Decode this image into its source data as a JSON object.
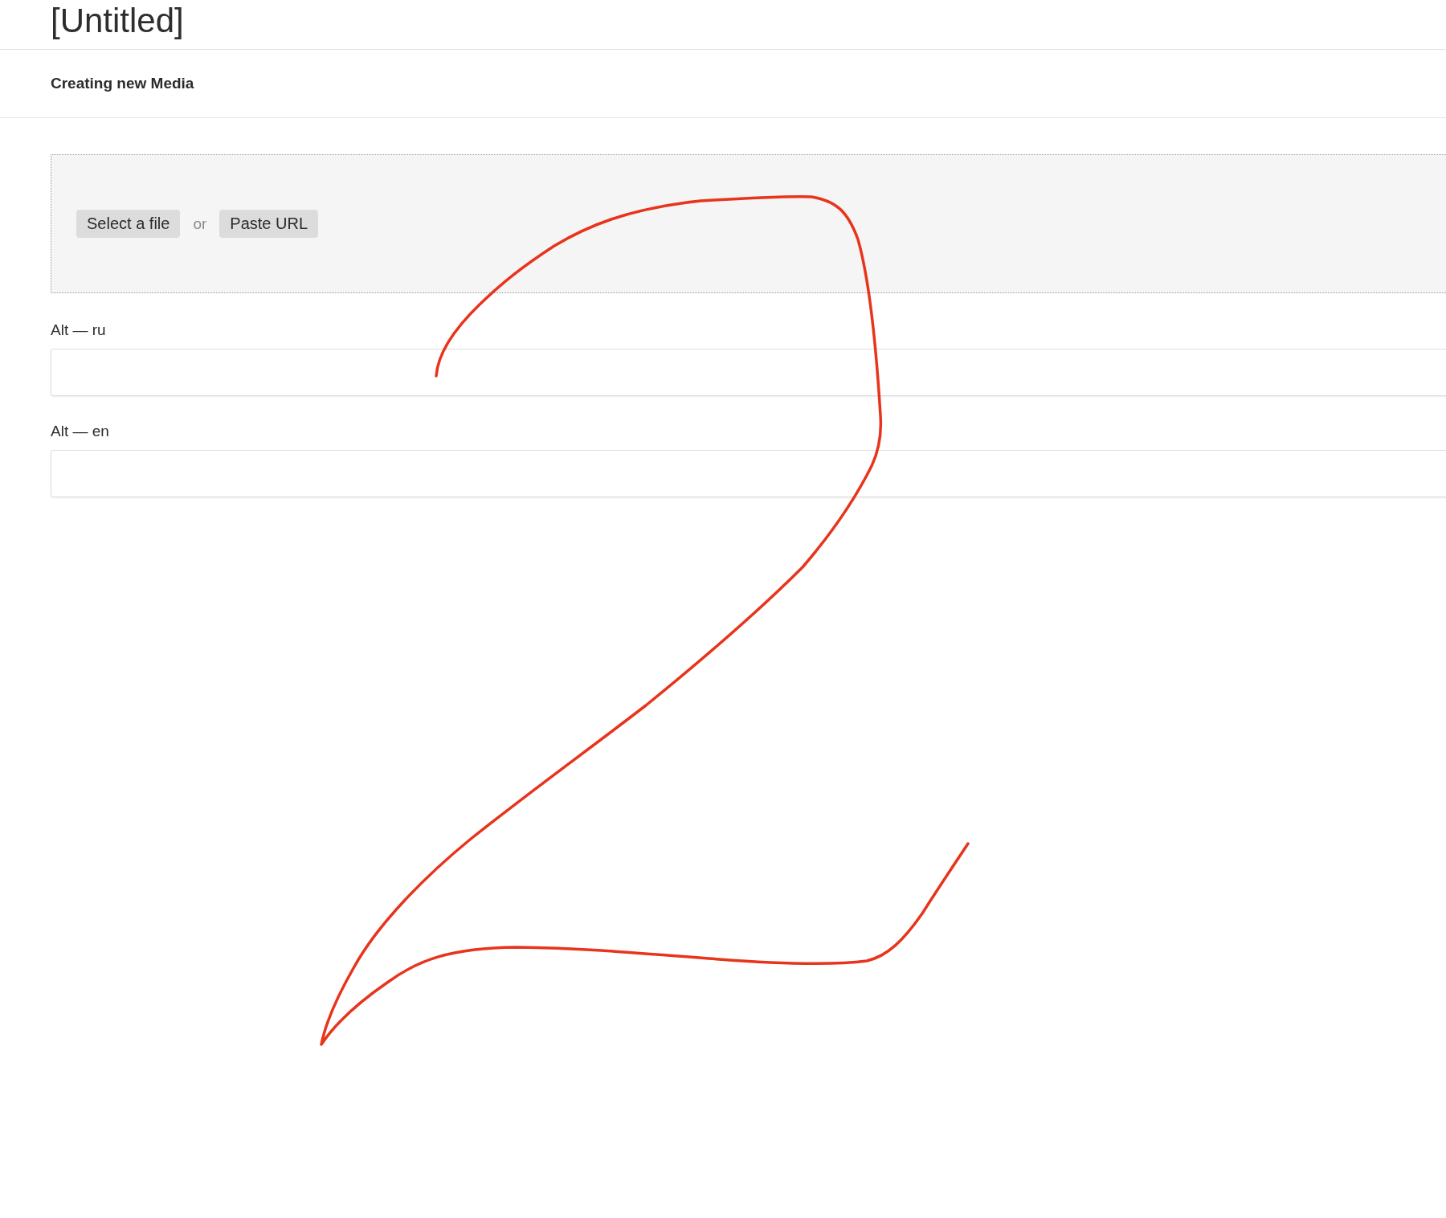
{
  "page": {
    "title": "[Untitled]"
  },
  "header": {
    "title": "Creating new Media"
  },
  "upload": {
    "buttons": [
      {
        "label": "Select a file"
      },
      {
        "label": "Paste URL"
      }
    ],
    "separator": "or"
  },
  "fields": [
    {
      "label": "Alt — ru"
    },
    {
      "label": "Alt — en"
    }
  ]
}
